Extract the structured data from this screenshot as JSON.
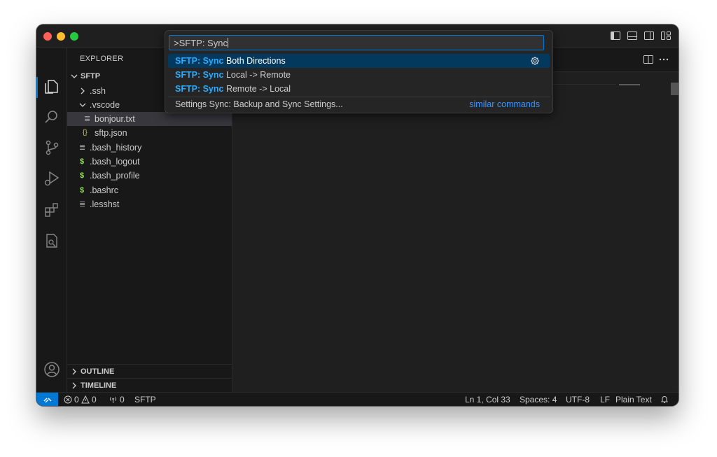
{
  "explorer": {
    "title": "EXPLORER",
    "root": "SFTP",
    "tree": [
      {
        "label": ".ssh",
        "icon": "chevron-right"
      },
      {
        "label": ".vscode",
        "icon": "chevron-down"
      },
      {
        "label": "bonjour.txt",
        "icon": "text-file-icon"
      },
      {
        "label": "sftp.json",
        "icon": "json-file-icon"
      },
      {
        "label": ".bash_history",
        "icon": "text-file-icon"
      },
      {
        "label": ".bash_logout",
        "icon": "shell-file-icon"
      },
      {
        "label": ".bash_profile",
        "icon": "shell-file-icon"
      },
      {
        "label": ".bashrc",
        "icon": "shell-file-icon"
      },
      {
        "label": ".lesshst",
        "icon": "text-file-icon"
      }
    ],
    "outline": "OUTLINE",
    "timeline": "TIMELINE"
  },
  "palette": {
    "input": ">SFTP: Sync",
    "items": [
      {
        "prefix": "SFTP: Sync",
        "rest": " Both Directions"
      },
      {
        "prefix": "SFTP: Sync",
        "rest": " Local -> Remote"
      },
      {
        "prefix": "SFTP: Sync",
        "rest": " Remote -> Local"
      }
    ],
    "footer_item": "Settings Sync: Backup and Sync Settings...",
    "similar": "similar commands"
  },
  "status": {
    "errors": "0",
    "warnings": "0",
    "ports": "0",
    "sftp": "SFTP",
    "position": "Ln 1, Col 33",
    "spaces": "Spaces: 4",
    "encoding": "UTF-8",
    "eol": "LF",
    "language": "Plain Text"
  },
  "colors": {
    "accent": "#0078d4",
    "highlight": "#2aaaff",
    "selection": "#04395e"
  }
}
